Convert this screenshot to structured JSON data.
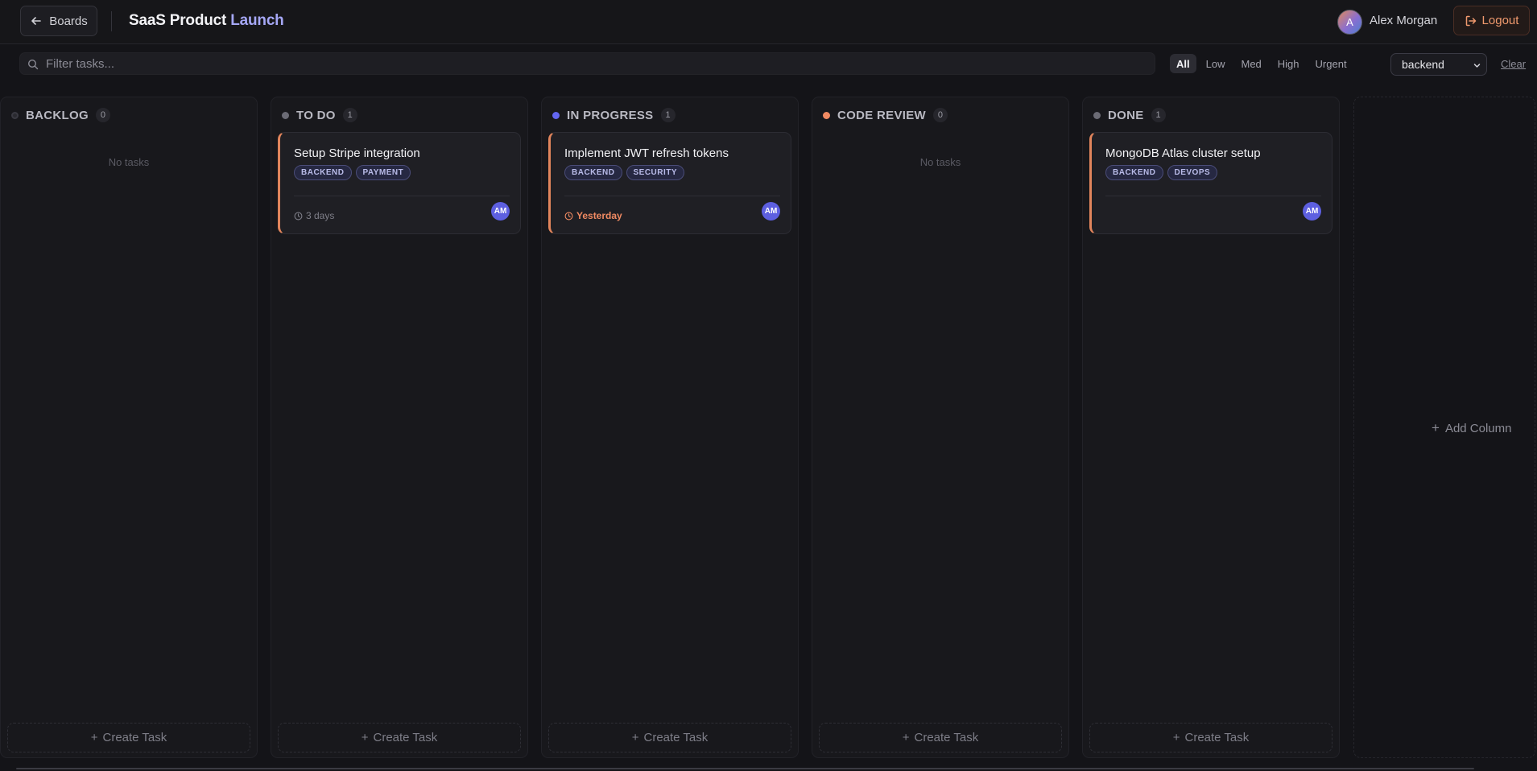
{
  "header": {
    "back_label": "Boards",
    "board_title_main": "SaaS Product",
    "board_title_accent": "Launch",
    "user_initial": "A",
    "user_name": "Alex Morgan",
    "logout_label": "Logout"
  },
  "filters": {
    "search_placeholder": "Filter tasks...",
    "priorities": [
      "All",
      "Low",
      "Med",
      "High",
      "Urgent"
    ],
    "active_priority": "All",
    "tag_selected": "backend",
    "clear_label": "Clear"
  },
  "colors": {
    "accent": "#a5a7f5",
    "backlog_dot": "#2a2a30",
    "todo_dot": "#6b6b75",
    "in_progress_dot": "#6366f1",
    "code_review_dot": "#f08a62",
    "done_dot": "#6b6b75",
    "card_priority_bar": "#e2855c",
    "assignee": "#5d5fe0"
  },
  "columns": [
    {
      "title": "BACKLOG",
      "count": "0",
      "empty_text": "No tasks",
      "create_label": "Create Task"
    },
    {
      "title": "TO DO",
      "count": "1",
      "create_label": "Create Task",
      "card": {
        "title": "Setup Stripe integration",
        "tags": [
          "BACKEND",
          "PAYMENT"
        ],
        "due": "3 days",
        "assignee": "AM"
      }
    },
    {
      "title": "IN PROGRESS",
      "count": "1",
      "create_label": "Create Task",
      "card": {
        "title": "Implement JWT refresh tokens",
        "tags": [
          "BACKEND",
          "SECURITY"
        ],
        "due": "Yesterday",
        "assignee": "AM"
      }
    },
    {
      "title": "CODE REVIEW",
      "count": "0",
      "empty_text": "No tasks",
      "create_label": "Create Task"
    },
    {
      "title": "DONE",
      "count": "1",
      "create_label": "Create Task",
      "card": {
        "title": "MongoDB Atlas cluster setup",
        "tags": [
          "BACKEND",
          "DEVOPS"
        ],
        "assignee": "AM"
      }
    }
  ],
  "add_column_label": "Add Column"
}
